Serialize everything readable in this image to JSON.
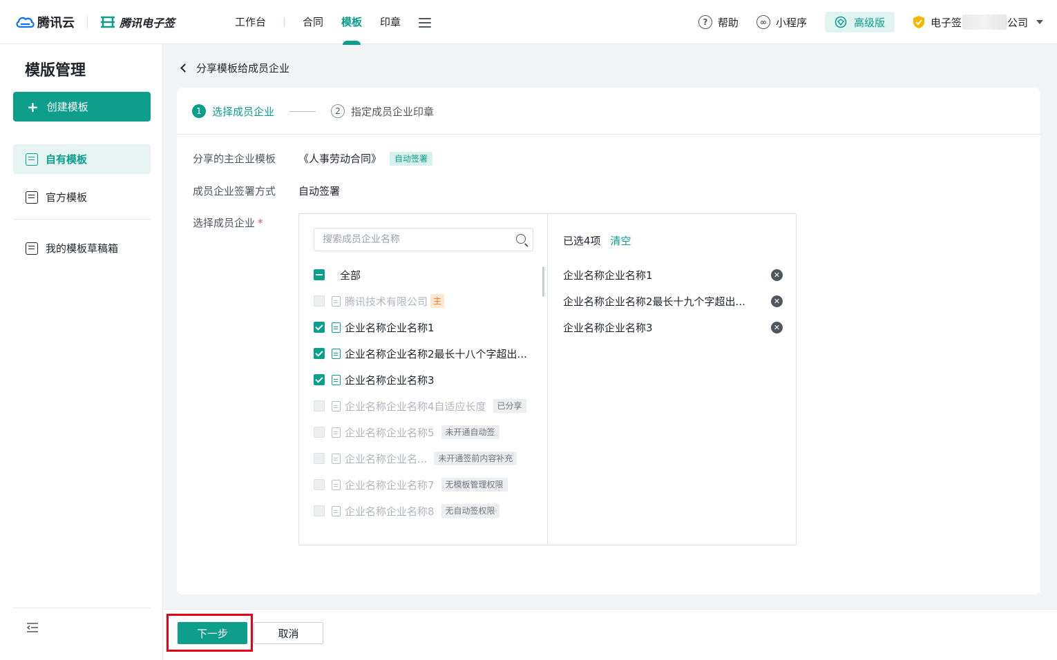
{
  "header": {
    "cloud_brand": "腾讯云",
    "esign_brand": "腾讯电子签",
    "nav": [
      {
        "label": "工作台"
      },
      {
        "label": "合同"
      },
      {
        "label": "模板"
      },
      {
        "label": "印章"
      }
    ],
    "active_nav": "模板",
    "help": "帮助",
    "mini_program": "小程序",
    "premium": "高级版",
    "company_prefix": "电子签",
    "company_suffix": "公司"
  },
  "sidebar": {
    "title": "模版管理",
    "create_button": "创建模板",
    "items": [
      {
        "label": "自有模板",
        "active": true
      },
      {
        "label": "官方模板",
        "active": false
      },
      {
        "label": "我的模板草稿箱",
        "active": false
      }
    ]
  },
  "main": {
    "back_title": "分享模板给成员企业",
    "steps": [
      {
        "num": "1",
        "label": "选择成员企业"
      },
      {
        "num": "2",
        "label": "指定成员企业印章"
      }
    ],
    "form": {
      "template_label": "分享的主企业模板",
      "template_value": "《人事劳动合同》",
      "template_tag": "自动签署",
      "sign_method_label": "成员企业签署方式",
      "sign_method_value": "自动签署",
      "select_label": "选择成员企业",
      "required_mark": "*"
    },
    "transfer": {
      "search_placeholder": "搜索成员企业名称",
      "all_label": "全部",
      "options": [
        {
          "label": "腾讯技术有限公司",
          "badge": "主",
          "state": "main"
        },
        {
          "label": "企业名称企业名称1",
          "badge": "",
          "state": "checked"
        },
        {
          "label": "企业名称企业名称2最长十八个字超出...",
          "badge": "",
          "state": "checked"
        },
        {
          "label": "企业名称企业名称3",
          "badge": "",
          "state": "checked"
        },
        {
          "label": "企业名称企业名称4自适应长度",
          "badge": "已分享",
          "state": "disabled"
        },
        {
          "label": "企业名称企业名称5",
          "badge": "未开通自动签",
          "state": "disabled"
        },
        {
          "label": "企业名称企业名...",
          "badge": "未开通签前内容补充",
          "state": "disabled"
        },
        {
          "label": "企业名称企业名称7",
          "badge": "无模板管理权限",
          "state": "disabled"
        },
        {
          "label": "企业名称企业名称8",
          "badge": "无自动签权限",
          "state": "disabled"
        }
      ],
      "selected_count_text": "已选4项",
      "clear_label": "清空",
      "selected": [
        {
          "label": "企业名称企业名称1"
        },
        {
          "label": "企业名称企业名称2最长十九个字超出..."
        },
        {
          "label": "企业名称企业名称3"
        }
      ]
    },
    "footer": {
      "next_label": "下一步",
      "cancel_label": "取消"
    }
  },
  "colors": {
    "accent": "#0a9e8c",
    "highlight": "#e60012"
  }
}
